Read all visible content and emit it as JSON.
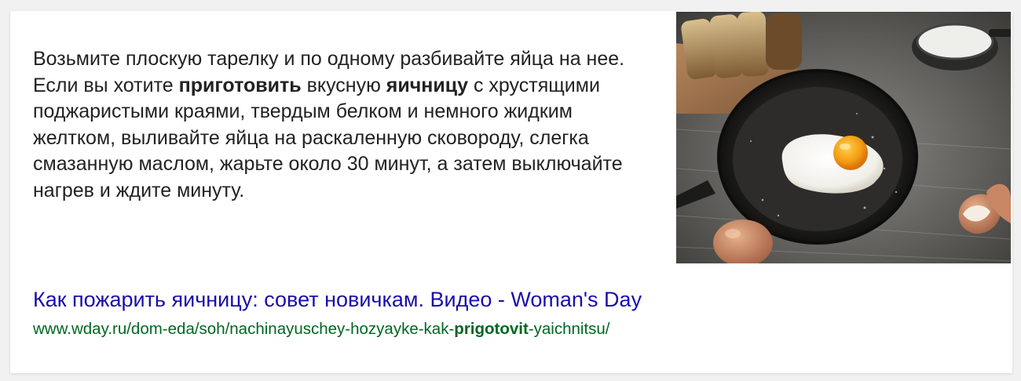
{
  "snippet": {
    "part1": "Возьмите плоскую тарелку и по одному разбивайте яйца на нее. Если вы хотите ",
    "bold1": "приготовить",
    "part2": " вкусную ",
    "bold2": "яичницу",
    "part3": " с хрустящими поджаристыми краями, твердым белком и немного жидким желтком, выливайте яйца на раскаленную сковороду, слегка смазанную маслом, жарьте около 30 минут, а затем выключайте нагрев и ждите минуту."
  },
  "image": {
    "icon": "fried-egg-in-pan-photo"
  },
  "result": {
    "title": "Как пожарить яичницу: совет новичкам. Видео - Woman's Day",
    "url_part1": "www.wday.ru/dom-eda/soh/nachinayuschey-hozyayke-kak-",
    "url_bold": "prigotovit",
    "url_part2": "-yaichnitsu/"
  },
  "colors": {
    "link": "#1a0dab",
    "url": "#006621",
    "text": "#222222"
  }
}
